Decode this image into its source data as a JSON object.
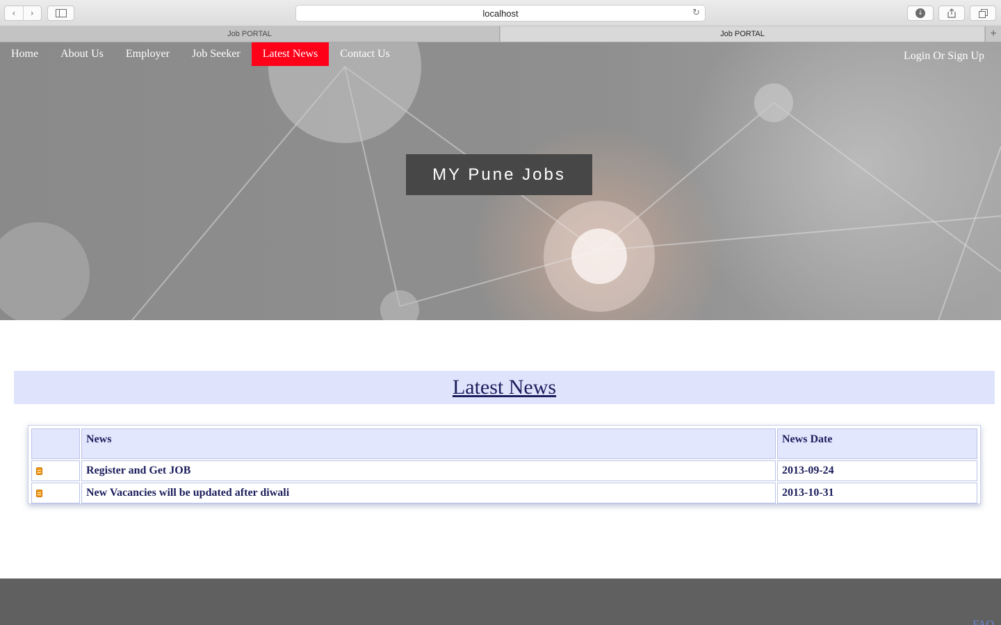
{
  "browser": {
    "url": "localhost",
    "tabs": [
      "Job PORTAL",
      "Job PORTAL"
    ],
    "icons": {
      "back": "chevron-left-icon",
      "forward": "chevron-right-icon",
      "sidebar": "sidebar-icon",
      "reload": "reload-icon",
      "download": "download-icon",
      "share": "share-icon",
      "tabs": "tabs-icon",
      "new_tab": "plus-icon"
    }
  },
  "nav": {
    "items": [
      "Home",
      "About Us",
      "Employer",
      "Job Seeker",
      "Latest News",
      "Contact Us"
    ],
    "active": "Latest News",
    "login": "Login Or Sign Up"
  },
  "hero": {
    "title": "MY Pune Jobs"
  },
  "section": {
    "title": "Latest News"
  },
  "news_table": {
    "headers": [
      "",
      "News",
      "News Date"
    ],
    "rows": [
      {
        "icon": "document-icon",
        "news": "Register and Get JOB",
        "date": "2013-09-24"
      },
      {
        "icon": "document-icon",
        "news": "New Vacancies will be updated after diwali",
        "date": "2013-10-31"
      }
    ]
  },
  "footer": {
    "link": "FAQ"
  },
  "colors": {
    "active_nav": "#ff0019",
    "banner_bg": "#dfe3fb",
    "text_navy": "#1b1d5c",
    "footer_bg": "#606060",
    "title_box": "#474747"
  }
}
